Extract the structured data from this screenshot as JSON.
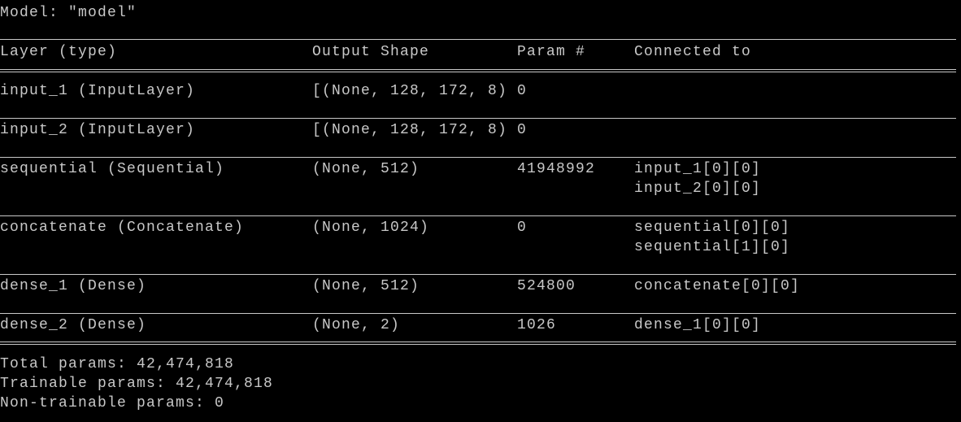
{
  "title": "Model: \"model\"",
  "columns": [
    "Layer (type)",
    "Output Shape",
    "Param #",
    "Connected to"
  ],
  "rows": [
    {
      "layer": "input_1 (InputLayer)",
      "shape": "[(None, 128, 172, 8)",
      "params": "0",
      "connected": []
    },
    {
      "layer": "input_2 (InputLayer)",
      "shape": "[(None, 128, 172, 8)",
      "params": "0",
      "connected": []
    },
    {
      "layer": "sequential (Sequential)",
      "shape": "(None, 512)",
      "params": "41948992",
      "connected": [
        "input_1[0][0]",
        "input_2[0][0]"
      ]
    },
    {
      "layer": "concatenate (Concatenate)",
      "shape": "(None, 1024)",
      "params": "0",
      "connected": [
        "sequential[0][0]",
        "sequential[1][0]"
      ]
    },
    {
      "layer": "dense_1 (Dense)",
      "shape": "(None, 512)",
      "params": "524800",
      "connected": [
        "concatenate[0][0]"
      ]
    },
    {
      "layer": "dense_2 (Dense)",
      "shape": "(None, 2)",
      "params": "1026",
      "connected": [
        "dense_1[0][0]"
      ]
    }
  ],
  "summary": {
    "total": "Total params: 42,474,818",
    "trainable": "Trainable params: 42,474,818",
    "non_trainable": "Non-trainable params: 0"
  }
}
